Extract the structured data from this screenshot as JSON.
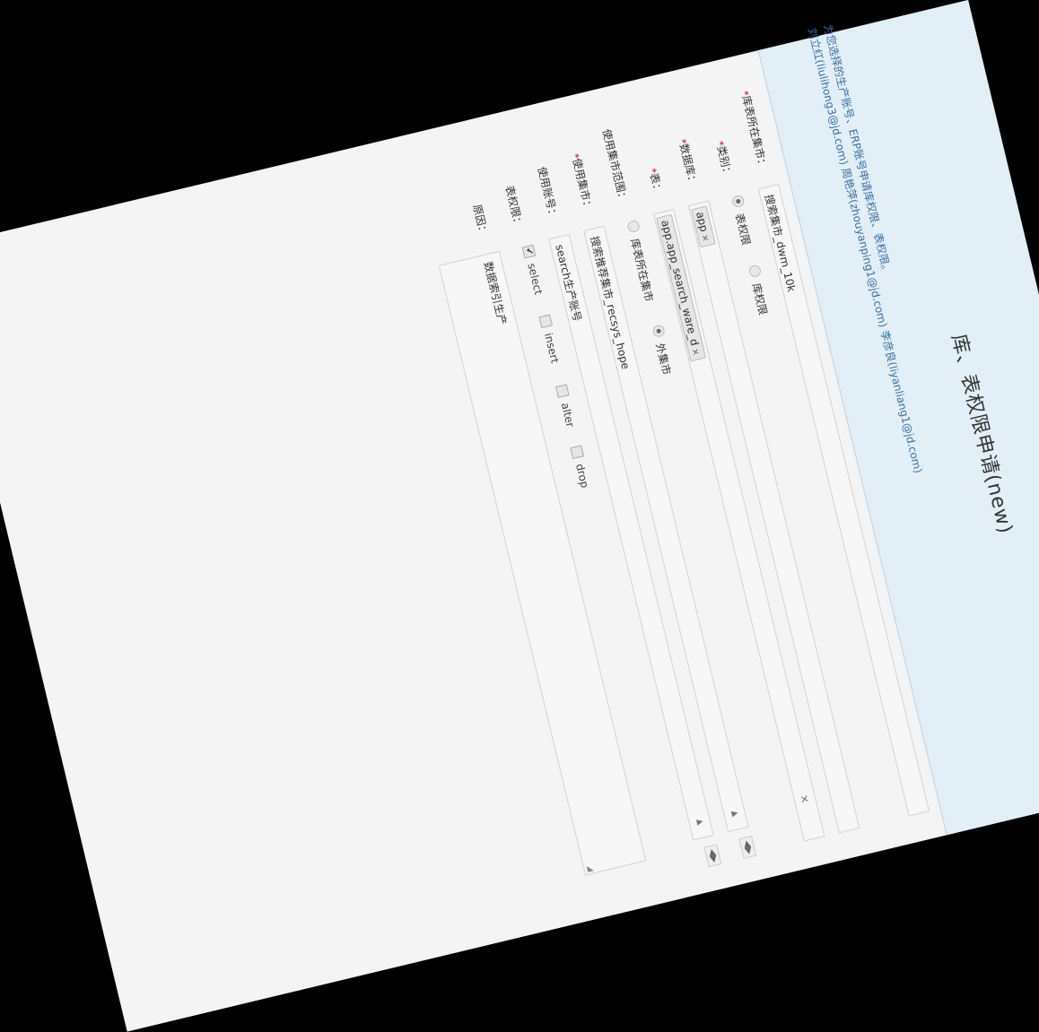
{
  "title": "库、表权限申请(new)",
  "notice": [
    "为您选择的生产账号、ERP账号申请库权限、表权限。",
    "刘立红(liulihong3@jd.com) 周艳萍(zhouyanping1@jd.com) 李彦良(liyanliang1@jd.com)"
  ],
  "required_mark": "*",
  "fields": {
    "market": {
      "label": "库表所在集市：",
      "value": "搜索集市_dwm_10k"
    },
    "type": {
      "label": "类别：",
      "options": [
        "表权限",
        "库权限"
      ],
      "selected": "表权限"
    },
    "database": {
      "label": "数据库：",
      "tags": [
        "app"
      ],
      "remove": "×"
    },
    "table": {
      "label": "表：",
      "tags": [
        "app.app_search_ware_d"
      ],
      "remove": "×"
    },
    "scope": {
      "label": "使用集市范围：",
      "options": [
        "库表所在集市",
        "外集市"
      ],
      "selected": "外集市"
    },
    "use_market": {
      "label": "使用集市：",
      "value": "搜索推荐集市_recsys_hope"
    },
    "use_account": {
      "label": "使用账号：",
      "value": "search生产账号"
    },
    "table_perm": {
      "label": "表权限：",
      "options": [
        "select",
        "insert",
        "alter",
        "drop"
      ],
      "checked": [
        "select"
      ]
    },
    "reason": {
      "label": "原因：",
      "value": "数据索引生产"
    }
  },
  "icons": {
    "clear": "×",
    "dropdown": "▲",
    "check": "✔",
    "prev": "◀",
    "next": "▶",
    "grip": "◢"
  }
}
